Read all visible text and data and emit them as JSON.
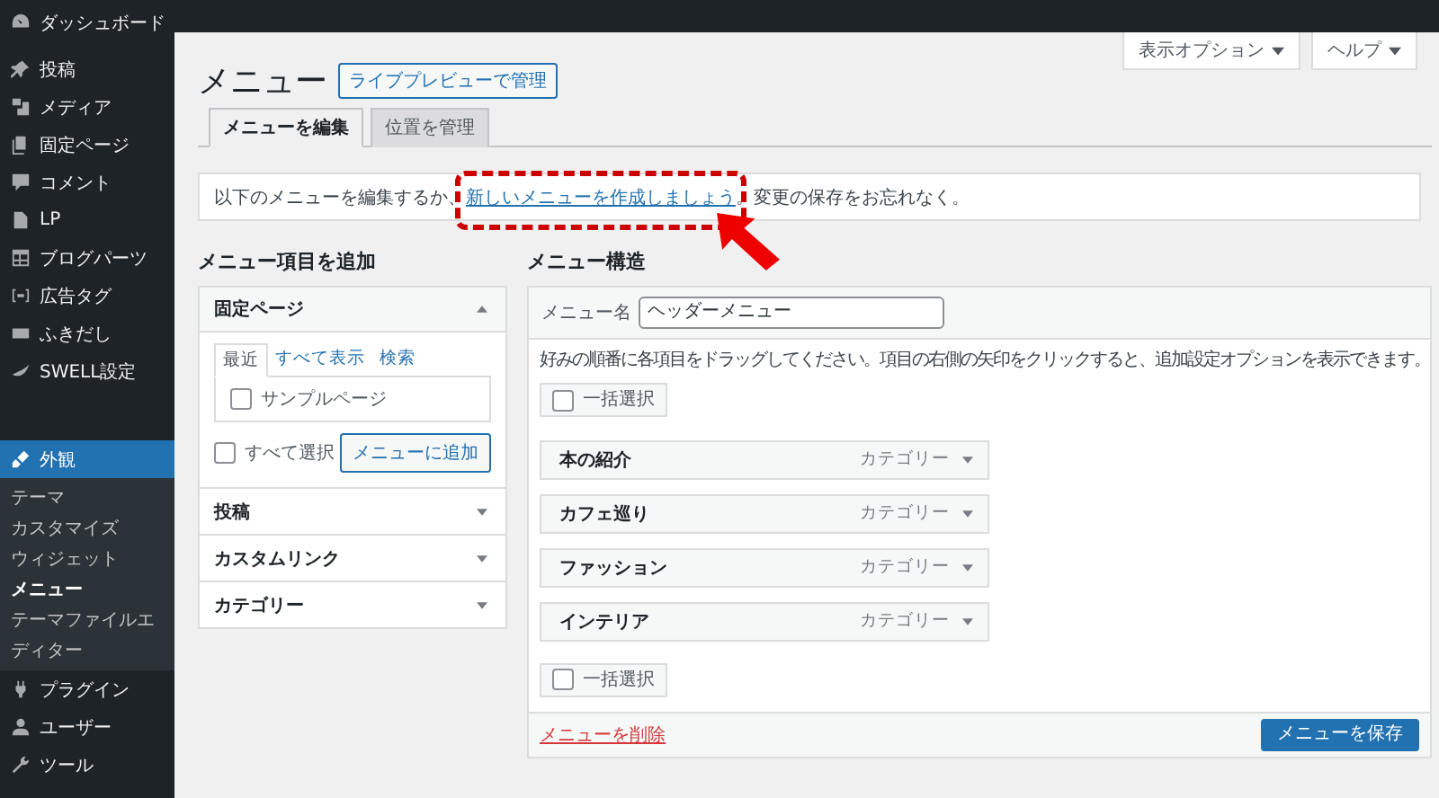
{
  "sidebar": {
    "items": [
      {
        "label": "ダッシュボード",
        "selected": false
      },
      {
        "label": "投稿",
        "selected": false
      },
      {
        "label": "メディア",
        "selected": false
      },
      {
        "label": "固定ページ",
        "selected": false
      },
      {
        "label": "コメント",
        "selected": false
      },
      {
        "label": "LP",
        "selected": false
      },
      {
        "label": "ブログパーツ",
        "selected": false
      },
      {
        "label": "広告タグ",
        "selected": false
      },
      {
        "label": "ふきだし",
        "selected": false
      },
      {
        "label": "SWELL設定",
        "selected": false
      },
      {
        "label": "外観",
        "selected": true,
        "children": [
          {
            "label": "テーマ",
            "selected": false
          },
          {
            "label": "カスタマイズ",
            "selected": false
          },
          {
            "label": "ウィジェット",
            "selected": false
          },
          {
            "label": "メニュー",
            "selected": true
          },
          {
            "label": "テーマファイルエディター",
            "selected": false
          }
        ]
      },
      {
        "label": "プラグイン",
        "selected": false
      },
      {
        "label": "ユーザー",
        "selected": false
      },
      {
        "label": "ツール",
        "selected": false
      }
    ]
  },
  "screen_options": [
    "表示オプション",
    "ヘルプ"
  ],
  "page": {
    "title": "メニュー",
    "action": "ライブプレビューで管理"
  },
  "tabs": [
    {
      "label": "メニューを編集",
      "selected": true
    },
    {
      "label": "位置を管理",
      "selected": false
    }
  ],
  "notice": {
    "before": "以下のメニューを編集するか、",
    "link": "新しいメニューを作成しましょう",
    "after": "。変更の保存をお忘れなく。"
  },
  "add_items": {
    "heading": "メニュー項目を追加",
    "sections": [
      {
        "title": "固定ページ",
        "expanded": true,
        "tabs": [
          {
            "label": "最近",
            "selected": true
          },
          {
            "label": "すべて表示",
            "selected": false
          },
          {
            "label": "検索",
            "selected": false
          }
        ],
        "pages": [
          {
            "label": "サンプルページ",
            "checked": false
          }
        ],
        "select_all": {
          "label": "すべて選択",
          "checked": false
        },
        "add_button": "メニューに追加"
      },
      {
        "title": "投稿",
        "expanded": false
      },
      {
        "title": "カスタムリンク",
        "expanded": false
      },
      {
        "title": "カテゴリー",
        "expanded": false
      }
    ]
  },
  "structure": {
    "heading": "メニュー構造",
    "name_label": "メニュー名",
    "name_value": "ヘッダーメニュー",
    "hint": "好みの順番に各項目をドラッグしてください。項目の右側の矢印をクリックすると、追加設定オプションを表示できます。",
    "bulk_select_top": {
      "label": "一括選択",
      "checked": false
    },
    "items": [
      {
        "title": "本の紹介",
        "type": "カテゴリー"
      },
      {
        "title": "カフェ巡り",
        "type": "カテゴリー"
      },
      {
        "title": "ファッション",
        "type": "カテゴリー"
      },
      {
        "title": "インテリア",
        "type": "カテゴリー"
      }
    ],
    "bulk_select_bottom": {
      "label": "一括選択",
      "checked": false
    },
    "delete_link": "メニューを削除",
    "save_button": "メニューを保存"
  }
}
